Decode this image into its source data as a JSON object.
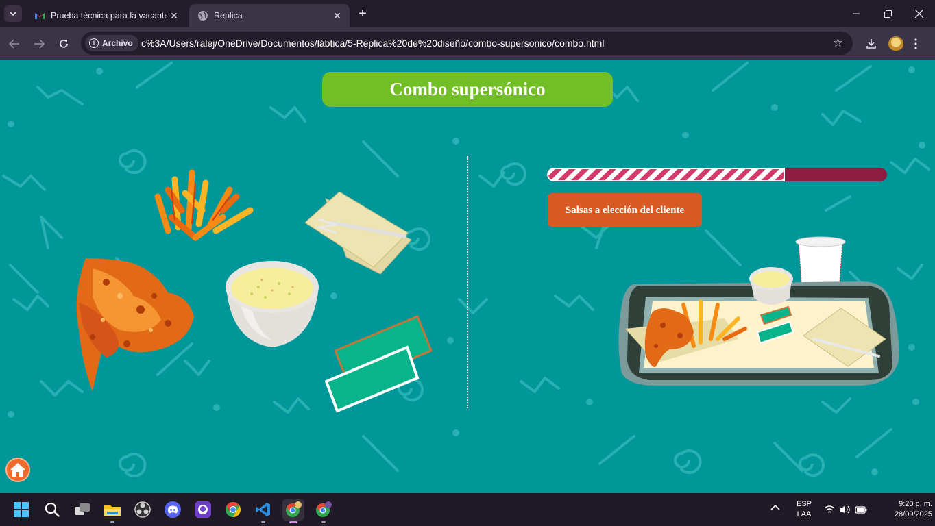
{
  "browser": {
    "tabs": [
      {
        "title": "Prueba técnica para la vacante d",
        "favicon": "gmail-icon",
        "active": false
      },
      {
        "title": "Replica",
        "favicon": "globe-icon",
        "active": true
      }
    ],
    "new_tab_label": "+",
    "address": {
      "chip_label": "Archivo",
      "url": "c%3A/Users/ralej/OneDrive/Documentos/lábtica/5-Replica%20de%20diseño/combo-supersonico/combo.html"
    }
  },
  "page": {
    "title": "Combo supersónico",
    "progress_percent": 70,
    "sauce_button_label": "Salsas a elección del cliente",
    "colors": {
      "background": "#00979a",
      "title_bg": "#72be26",
      "sauce_bg": "#d75a24",
      "progress_track": "#8b1d40",
      "progress_stripe": "#d43a68",
      "home_bg": "#f06a2c"
    },
    "left_items": [
      "chicken-wings",
      "french-fries",
      "napkins-with-fork",
      "rice-bowl",
      "sauce-packets"
    ],
    "tray_items": [
      "chicken-wings",
      "french-fries",
      "rice-bowl",
      "sauce-packets",
      "napkins-with-fork",
      "drink-cup"
    ]
  },
  "taskbar": {
    "apps": [
      "start-icon",
      "search-icon",
      "task-view-icon",
      "file-explorer-icon",
      "obs-icon",
      "discord-icon",
      "github-desktop-icon",
      "chrome-icon",
      "vscode-icon",
      "chrome-profile-icon",
      "chrome-profile-2-icon"
    ],
    "language": "ESP",
    "layout": "LAA",
    "time": "9:20 p. m.",
    "date": "28/09/2025"
  }
}
